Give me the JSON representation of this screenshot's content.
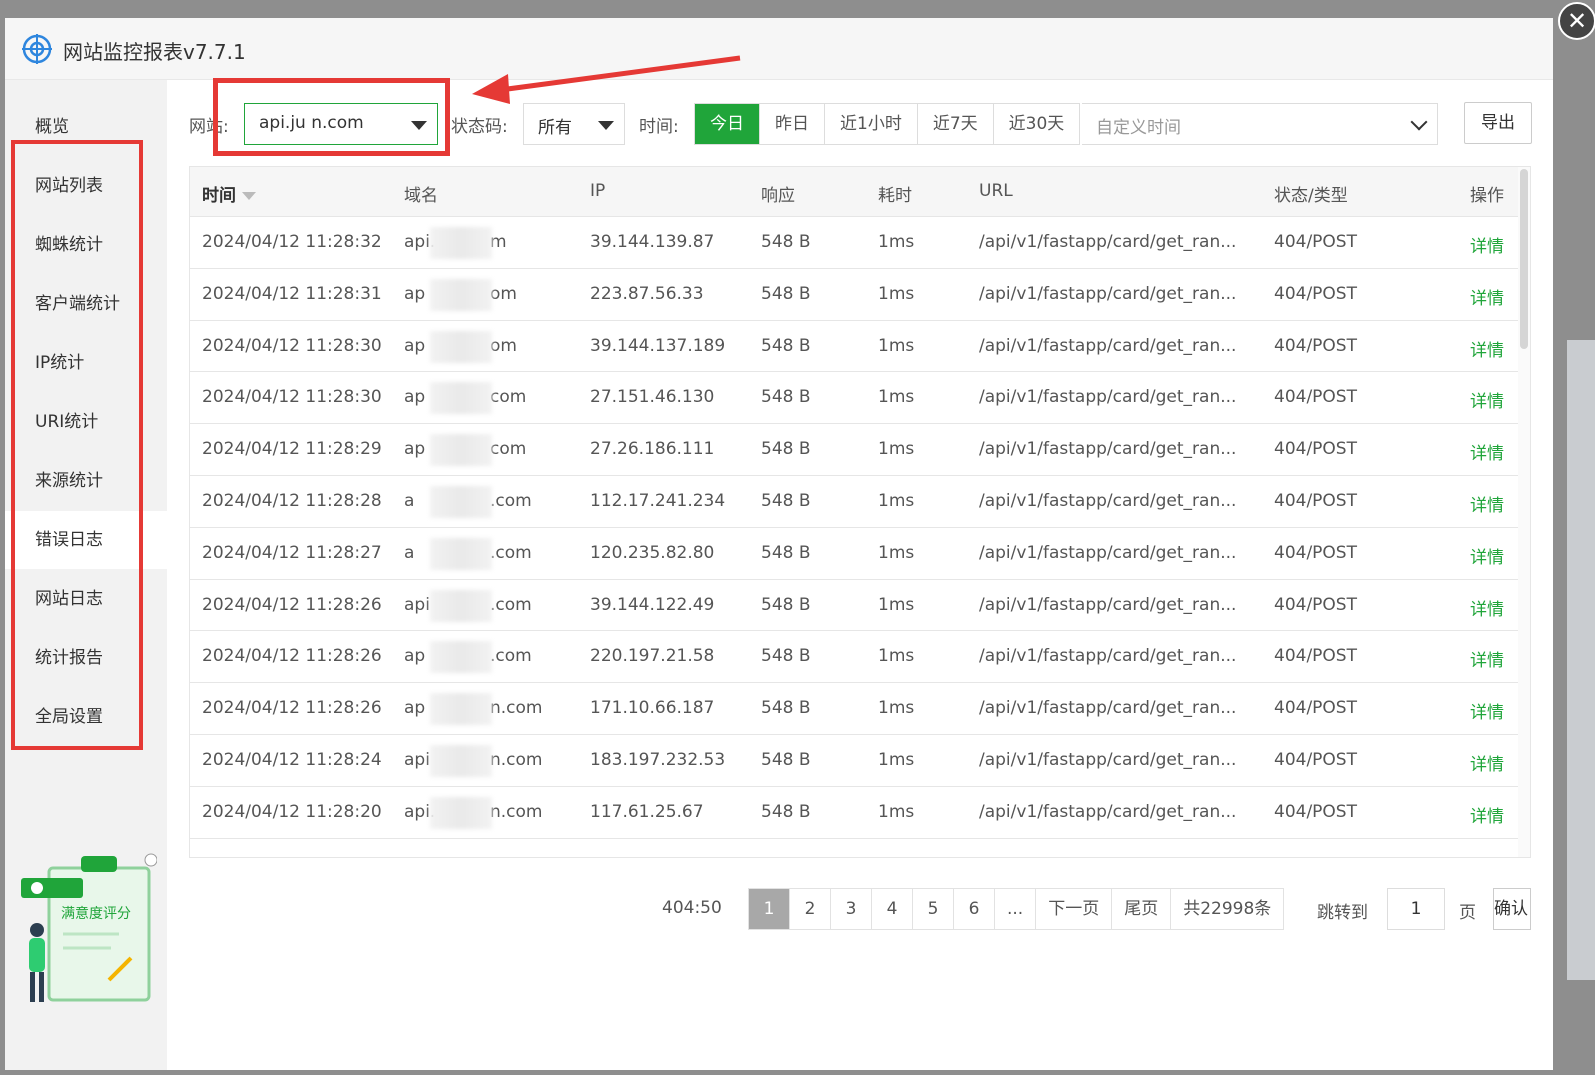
{
  "window": {
    "title": "网站监控报表v7.7.1"
  },
  "sidebar": {
    "items": [
      {
        "label": "概览"
      },
      {
        "label": "网站列表"
      },
      {
        "label": "蜘蛛统计"
      },
      {
        "label": "客户端统计"
      },
      {
        "label": "IP统计"
      },
      {
        "label": "URI统计"
      },
      {
        "label": "来源统计"
      },
      {
        "label": "错误日志",
        "active": true
      },
      {
        "label": "网站日志"
      },
      {
        "label": "统计报告"
      },
      {
        "label": "全局设置"
      }
    ],
    "promo_label": "满意度评分"
  },
  "filters": {
    "site_label": "网站:",
    "site_value": "api.ju        n.com",
    "status_label": "状态码:",
    "status_value": "所有",
    "time_label": "时间:",
    "time_options": [
      "今日",
      "昨日",
      "近1小时",
      "近7天",
      "近30天"
    ],
    "time_active": "今日",
    "custom_time_placeholder": "自定义时间",
    "export_label": "导出"
  },
  "table": {
    "columns": [
      "时间",
      "域名",
      "IP",
      "响应",
      "耗时",
      "URL",
      "状态/类型",
      "操作"
    ],
    "rows": [
      {
        "time": "2024/04/12 11:28:32",
        "domain_prefix": "api.",
        "domain_suffix": "m",
        "ip": "39.144.139.87",
        "size": "548 B",
        "cost": "1ms",
        "url": "/api/v1/fastapp/card/get_ran...",
        "status": "404/POST",
        "op": "详情"
      },
      {
        "time": "2024/04/12 11:28:31",
        "domain_prefix": "ap",
        "domain_suffix": "om",
        "ip": "223.87.56.33",
        "size": "548 B",
        "cost": "1ms",
        "url": "/api/v1/fastapp/card/get_ran...",
        "status": "404/POST",
        "op": "详情"
      },
      {
        "time": "2024/04/12 11:28:30",
        "domain_prefix": "ap",
        "domain_suffix": "om",
        "ip": "39.144.137.189",
        "size": "548 B",
        "cost": "1ms",
        "url": "/api/v1/fastapp/card/get_ran...",
        "status": "404/POST",
        "op": "详情"
      },
      {
        "time": "2024/04/12 11:28:30",
        "domain_prefix": "ap",
        "domain_suffix": "com",
        "ip": "27.151.46.130",
        "size": "548 B",
        "cost": "1ms",
        "url": "/api/v1/fastapp/card/get_ran...",
        "status": "404/POST",
        "op": "详情"
      },
      {
        "time": "2024/04/12 11:28:29",
        "domain_prefix": "ap",
        "domain_suffix": "com",
        "ip": "27.26.186.111",
        "size": "548 B",
        "cost": "1ms",
        "url": "/api/v1/fastapp/card/get_ran...",
        "status": "404/POST",
        "op": "详情"
      },
      {
        "time": "2024/04/12 11:28:28",
        "domain_prefix": "a",
        "domain_suffix": ".com",
        "ip": "112.17.241.234",
        "size": "548 B",
        "cost": "1ms",
        "url": "/api/v1/fastapp/card/get_ran...",
        "status": "404/POST",
        "op": "详情"
      },
      {
        "time": "2024/04/12 11:28:27",
        "domain_prefix": "a",
        "domain_suffix": ".com",
        "ip": "120.235.82.80",
        "size": "548 B",
        "cost": "1ms",
        "url": "/api/v1/fastapp/card/get_ran...",
        "status": "404/POST",
        "op": "详情"
      },
      {
        "time": "2024/04/12 11:28:26",
        "domain_prefix": "api",
        "domain_suffix": ".com",
        "ip": "39.144.122.49",
        "size": "548 B",
        "cost": "1ms",
        "url": "/api/v1/fastapp/card/get_ran...",
        "status": "404/POST",
        "op": "详情"
      },
      {
        "time": "2024/04/12 11:28:26",
        "domain_prefix": "ap",
        "domain_suffix": ".com",
        "ip": "220.197.21.58",
        "size": "548 B",
        "cost": "1ms",
        "url": "/api/v1/fastapp/card/get_ran...",
        "status": "404/POST",
        "op": "详情"
      },
      {
        "time": "2024/04/12 11:28:26",
        "domain_prefix": "ap",
        "domain_suffix": "n.com",
        "ip": "171.10.66.187",
        "size": "548 B",
        "cost": "1ms",
        "url": "/api/v1/fastapp/card/get_ran...",
        "status": "404/POST",
        "op": "详情"
      },
      {
        "time": "2024/04/12 11:28:24",
        "domain_prefix": "api",
        "domain_suffix": "n.com",
        "ip": "183.197.232.53",
        "size": "548 B",
        "cost": "1ms",
        "url": "/api/v1/fastapp/card/get_ran...",
        "status": "404/POST",
        "op": "详情"
      },
      {
        "time": "2024/04/12 11:28:20",
        "domain_prefix": "api.",
        "domain_suffix": "n.com",
        "ip": "117.61.25.67",
        "size": "548 B",
        "cost": "1ms",
        "url": "/api/v1/fastapp/card/get_ran...",
        "status": "404/POST",
        "op": "详情"
      }
    ]
  },
  "pagination": {
    "summary": "404:50",
    "pages": [
      "1",
      "2",
      "3",
      "4",
      "5",
      "6",
      "..."
    ],
    "active_page": "1",
    "next_label": "下一页",
    "last_label": "尾页",
    "total_label": "共22998条",
    "jump_label": "跳转到",
    "jump_value": "1",
    "page_unit": "页",
    "confirm_label": "确认"
  },
  "colors": {
    "accent": "#20a53a",
    "highlight": "#e53935"
  }
}
